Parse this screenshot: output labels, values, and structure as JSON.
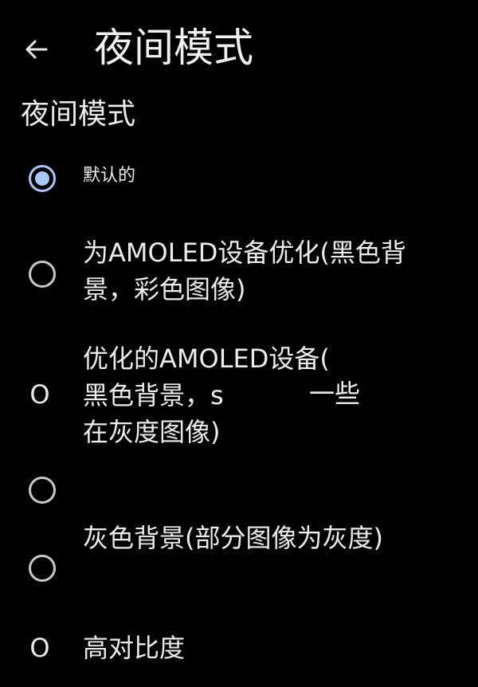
{
  "header": {
    "back_icon": "arrow-left-icon",
    "title": "夜间模式"
  },
  "section": {
    "title": "夜间模式"
  },
  "options": [
    {
      "label": "默认的",
      "selected": true
    },
    {
      "line1": "为AMOLED设备优化(黑色背",
      "line2": "景，彩色图像)",
      "selected": false
    },
    {
      "line1": "优化的AMOLED设备(",
      "line2": "黑色背景，s",
      "line2_extra": "一些",
      "line3": "在灰度图像)",
      "radio_glyph": "O",
      "selected": false
    },
    {
      "selected": false
    },
    {
      "label": "灰色背景(部分图像为灰度)",
      "selected": false
    },
    {
      "label": "高对比度",
      "radio_glyph": "O",
      "selected": false
    }
  ],
  "colors": {
    "background": "#000000",
    "accent": "#a9c6f2",
    "text": "#ececec",
    "radio_border": "#c8c8c8"
  }
}
